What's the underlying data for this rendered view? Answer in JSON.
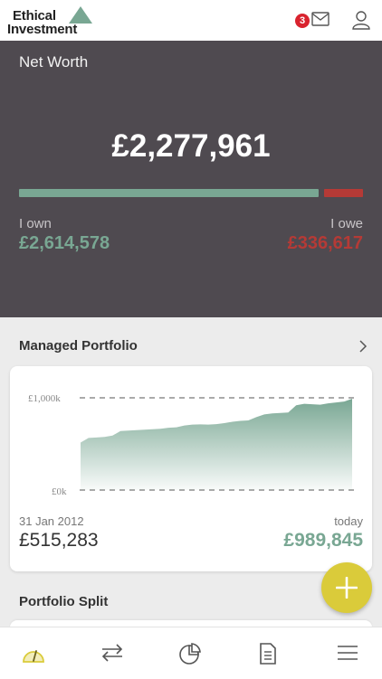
{
  "header": {
    "logo_line1": "Ethical",
    "logo_line2": "Investment",
    "mail_badge": "3",
    "icons": [
      "mail-icon",
      "user-icon"
    ]
  },
  "net_worth": {
    "title": "Net Worth",
    "total": "£2,277,961",
    "own_label": "I own",
    "own_value": "£2,614,578",
    "owe_label": "I owe",
    "owe_value": "£336,617",
    "own_share": 0.886,
    "colors": {
      "own": "#79a793",
      "owe": "#b53a36",
      "panel": "#4f4a50"
    }
  },
  "managed_portfolio": {
    "title": "Managed Portfolio",
    "start_date": "31 Jan 2012",
    "start_value": "£515,283",
    "end_label": "today",
    "end_value": "£989,845",
    "chart_data": {
      "type": "area",
      "y_ticks": [
        "£1,000k",
        "£0k"
      ],
      "ylim": [
        0,
        1000
      ],
      "x": [
        "31 Jan 2012",
        "today"
      ],
      "values": [
        515,
        565,
        570,
        575,
        590,
        640,
        645,
        650,
        655,
        660,
        665,
        675,
        680,
        700,
        710,
        712,
        710,
        715,
        725,
        740,
        750,
        755,
        790,
        820,
        830,
        835,
        840,
        920,
        935,
        930,
        925,
        940,
        950,
        960,
        990
      ],
      "color": "#79a793"
    }
  },
  "portfolio_split": {
    "title": "Portfolio Split"
  },
  "fab": {
    "icon": "plus-icon",
    "color": "#dacb3a"
  },
  "bottom_nav": {
    "items": [
      {
        "icon": "dashboard-gauge-icon",
        "active": true
      },
      {
        "icon": "transfer-arrows-icon",
        "active": false
      },
      {
        "icon": "pie-chart-icon",
        "active": false
      },
      {
        "icon": "document-icon",
        "active": false
      },
      {
        "icon": "hamburger-menu-icon",
        "active": false
      }
    ],
    "active_color": "#dacb3a"
  }
}
